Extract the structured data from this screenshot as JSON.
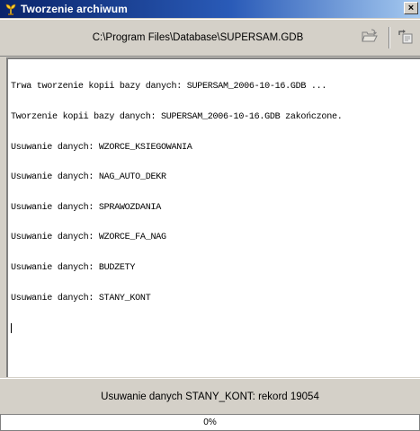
{
  "window": {
    "title": "Tworzenie archiwum",
    "app_icon": "plant-icon",
    "close_glyph": "×"
  },
  "toolbar": {
    "path": "C:\\Program Files\\Database\\SUPERSAM.GDB",
    "open_icon": "open-folder-icon",
    "export_icon": "export-icon"
  },
  "log": {
    "lines": [
      "Trwa tworzenie kopii bazy danych: SUPERSAM_2006-10-16.GDB ...",
      "Tworzenie kopii bazy danych: SUPERSAM_2006-10-16.GDB zakończone.",
      "Usuwanie danych: WZORCE_KSIEGOWANIA",
      "Usuwanie danych: NAG_AUTO_DEKR",
      "Usuwanie danych: SPRAWOZDANIA",
      "Usuwanie danych: WZORCE_FA_NAG",
      "Usuwanie danych: BUDZETY",
      "Usuwanie danych: STANY_KONT"
    ]
  },
  "status": {
    "text": "Usuwanie danych STANY_KONT: rekord 19054"
  },
  "progress": {
    "label": "0%",
    "value": 0
  },
  "colors": {
    "title_start": "#0a246a",
    "title_end": "#a6caf0",
    "face": "#d4d0c8"
  }
}
